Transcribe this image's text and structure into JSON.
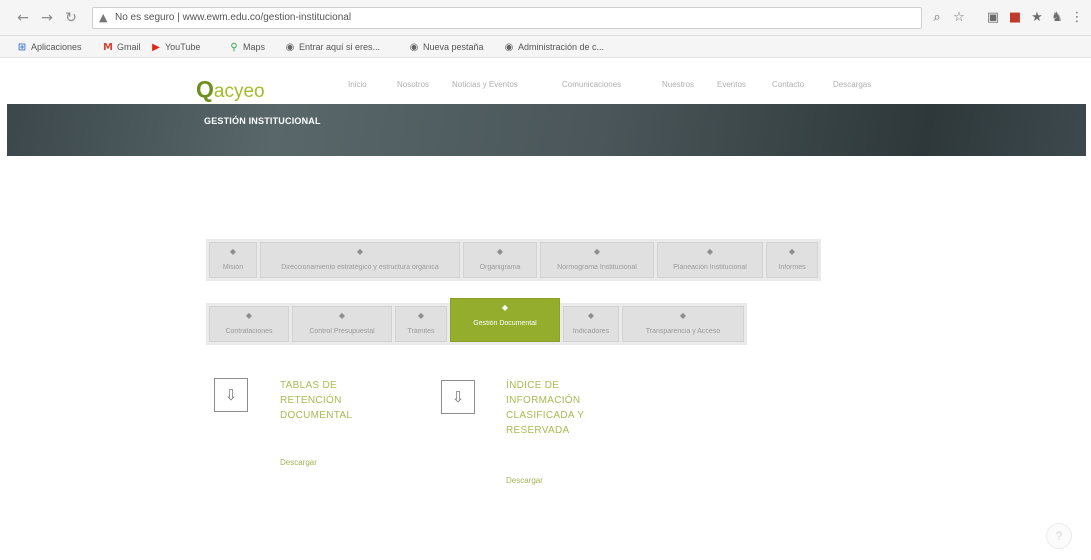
{
  "browser": {
    "url": "No es seguro | www.ewm.edu.co/gestion-institucional",
    "bookmarks": [
      {
        "label": "Aplicaciones",
        "icon": "apps-icon"
      },
      {
        "label": "Gmail",
        "icon": "gmail-icon"
      },
      {
        "label": "YouTube",
        "icon": "youtube-icon"
      },
      {
        "label": "Maps",
        "icon": "maps-icon"
      },
      {
        "label": "Entrar aquí si eres...",
        "icon": "globe-icon"
      },
      {
        "label": "Nueva pestaña",
        "icon": "globe-icon"
      },
      {
        "label": "Administración de c...",
        "icon": "globe-icon"
      }
    ]
  },
  "site": {
    "logo": {
      "q": "Q",
      "text": "acyeo"
    },
    "menu": [
      "Inicio",
      "Nosotros",
      "Noticias y Eventos",
      "Comunicaciones",
      "Nuestros",
      "Eventos",
      "Contacto",
      "Descargas"
    ]
  },
  "banner": {
    "title": "GESTIÓN INSTITUCIONAL"
  },
  "tabs_row1": [
    {
      "label": "Misión"
    },
    {
      "label": "Direccionamiento estratégico y estructura orgánica"
    },
    {
      "label": "Organigrama"
    },
    {
      "label": "Normograma Institucional"
    },
    {
      "label": "Planeación Institucional"
    },
    {
      "label": "Informes"
    }
  ],
  "tabs_row2": [
    {
      "label": "Contrataciones"
    },
    {
      "label": "Control Presupuestal"
    },
    {
      "label": "Trámites"
    },
    {
      "label": "Gestión Documental",
      "active": true
    },
    {
      "label": "Indicadores"
    },
    {
      "label": "Transparencia y Acceso"
    }
  ],
  "downloads": [
    {
      "title": "TABLAS DE\nRETENCIÓN\nDOCUMENTAL",
      "link": "Descargar"
    },
    {
      "title": "ÍNDICE DE\nINFORMACIÓN\nCLASIFICADA Y\nRESERVADA",
      "link": "Descargar"
    }
  ]
}
